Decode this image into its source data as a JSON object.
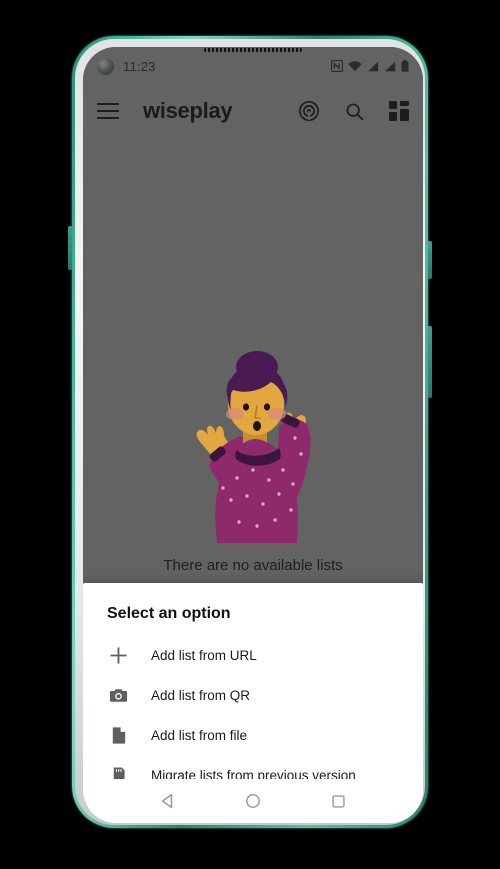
{
  "status_bar": {
    "time": "11:23",
    "icons": [
      "nfc-icon",
      "wifi-icon",
      "signal-icon-1",
      "signal-icon-2",
      "battery-icon"
    ]
  },
  "toolbar": {
    "menu_icon": "hamburger-menu-icon",
    "title": "wiseplay",
    "actions": [
      {
        "name": "cast-icon",
        "label": "Cast"
      },
      {
        "name": "search-icon",
        "label": "Search"
      },
      {
        "name": "grid-view-icon",
        "label": "Grid view"
      }
    ]
  },
  "empty_state": {
    "message": "There are no available lists",
    "illustration": "confused-woman-illustration"
  },
  "bottom_sheet": {
    "title": "Select an option",
    "options": [
      {
        "icon": "plus-icon",
        "label": "Add list from URL"
      },
      {
        "icon": "camera-icon",
        "label": "Add list from QR"
      },
      {
        "icon": "file-icon",
        "label": "Add list from file"
      },
      {
        "icon": "sd-card-icon",
        "label": "Migrate lists from previous version"
      }
    ]
  },
  "nav_bar": {
    "back": "back-button",
    "home": "home-button",
    "recents": "recents-button"
  },
  "colors": {
    "scrim": "#636363",
    "sheet_bg": "#ffffff",
    "icon_gray": "#5f5f5f",
    "text_primary": "#1b1b1b",
    "frame_teal": "#3e9e88",
    "hair_purple": "#4a1a52",
    "sweater_magenta": "#8e2a6b",
    "skin_tan": "#e2a73f"
  }
}
